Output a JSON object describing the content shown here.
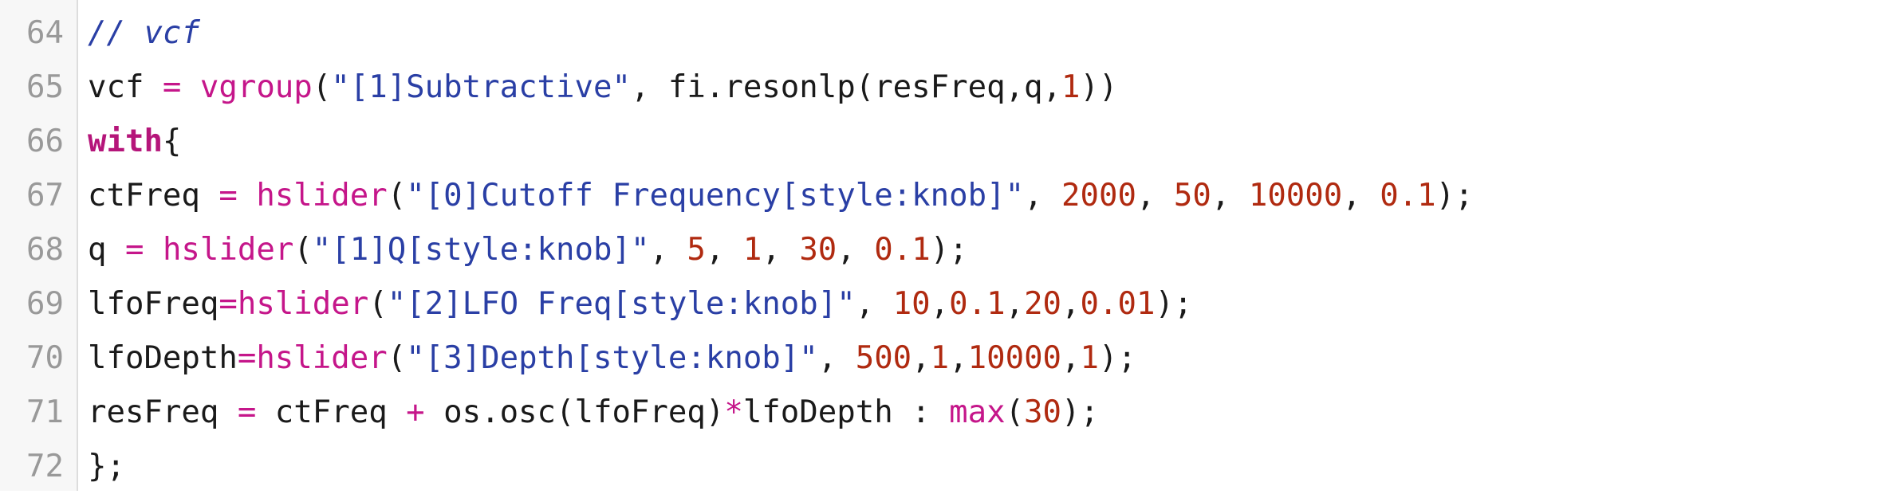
{
  "editor": {
    "language": "Faust",
    "colors": {
      "background": "#ffffff",
      "gutter": "#f7f7f7",
      "line_number": "#999999",
      "comment": "#2a3fa5",
      "keyword": "#b5157a",
      "function": "#c5168a",
      "string": "#2a3fa5",
      "number": "#b02a10",
      "text": "#1a1a1a"
    },
    "lines": [
      {
        "number": "64",
        "tokens": [
          {
            "t": "comment",
            "v": "// vcf"
          }
        ]
      },
      {
        "number": "65",
        "tokens": [
          {
            "t": "plain",
            "v": "vcf "
          },
          {
            "t": "op",
            "v": "="
          },
          {
            "t": "plain",
            "v": " "
          },
          {
            "t": "func",
            "v": "vgroup"
          },
          {
            "t": "plain",
            "v": "("
          },
          {
            "t": "string",
            "v": "\"[1]Subtractive\""
          },
          {
            "t": "plain",
            "v": ", fi.resonlp(resFreq,q,"
          },
          {
            "t": "number",
            "v": "1"
          },
          {
            "t": "plain",
            "v": "))"
          }
        ]
      },
      {
        "number": "66",
        "tokens": [
          {
            "t": "keyword",
            "v": "with"
          },
          {
            "t": "plain",
            "v": "{"
          }
        ]
      },
      {
        "number": "67",
        "tokens": [
          {
            "t": "plain",
            "v": "ctFreq "
          },
          {
            "t": "op",
            "v": "="
          },
          {
            "t": "plain",
            "v": " "
          },
          {
            "t": "func",
            "v": "hslider"
          },
          {
            "t": "plain",
            "v": "("
          },
          {
            "t": "string",
            "v": "\"[0]Cutoff Frequency[style:knob]\""
          },
          {
            "t": "plain",
            "v": ", "
          },
          {
            "t": "number",
            "v": "2000"
          },
          {
            "t": "plain",
            "v": ", "
          },
          {
            "t": "number",
            "v": "50"
          },
          {
            "t": "plain",
            "v": ", "
          },
          {
            "t": "number",
            "v": "10000"
          },
          {
            "t": "plain",
            "v": ", "
          },
          {
            "t": "number",
            "v": "0.1"
          },
          {
            "t": "plain",
            "v": ");"
          }
        ]
      },
      {
        "number": "68",
        "tokens": [
          {
            "t": "plain",
            "v": "q "
          },
          {
            "t": "op",
            "v": "="
          },
          {
            "t": "plain",
            "v": " "
          },
          {
            "t": "func",
            "v": "hslider"
          },
          {
            "t": "plain",
            "v": "("
          },
          {
            "t": "string",
            "v": "\"[1]Q[style:knob]\""
          },
          {
            "t": "plain",
            "v": ", "
          },
          {
            "t": "number",
            "v": "5"
          },
          {
            "t": "plain",
            "v": ", "
          },
          {
            "t": "number",
            "v": "1"
          },
          {
            "t": "plain",
            "v": ", "
          },
          {
            "t": "number",
            "v": "30"
          },
          {
            "t": "plain",
            "v": ", "
          },
          {
            "t": "number",
            "v": "0.1"
          },
          {
            "t": "plain",
            "v": ");"
          }
        ]
      },
      {
        "number": "69",
        "tokens": [
          {
            "t": "plain",
            "v": "lfoFreq"
          },
          {
            "t": "op",
            "v": "="
          },
          {
            "t": "func",
            "v": "hslider"
          },
          {
            "t": "plain",
            "v": "("
          },
          {
            "t": "string",
            "v": "\"[2]LFO Freq[style:knob]\""
          },
          {
            "t": "plain",
            "v": ", "
          },
          {
            "t": "number",
            "v": "10"
          },
          {
            "t": "plain",
            "v": ","
          },
          {
            "t": "number",
            "v": "0.1"
          },
          {
            "t": "plain",
            "v": ","
          },
          {
            "t": "number",
            "v": "20"
          },
          {
            "t": "plain",
            "v": ","
          },
          {
            "t": "number",
            "v": "0.01"
          },
          {
            "t": "plain",
            "v": ");"
          }
        ]
      },
      {
        "number": "70",
        "tokens": [
          {
            "t": "plain",
            "v": "lfoDepth"
          },
          {
            "t": "op",
            "v": "="
          },
          {
            "t": "func",
            "v": "hslider"
          },
          {
            "t": "plain",
            "v": "("
          },
          {
            "t": "string",
            "v": "\"[3]Depth[style:knob]\""
          },
          {
            "t": "plain",
            "v": ", "
          },
          {
            "t": "number",
            "v": "500"
          },
          {
            "t": "plain",
            "v": ","
          },
          {
            "t": "number",
            "v": "1"
          },
          {
            "t": "plain",
            "v": ","
          },
          {
            "t": "number",
            "v": "10000"
          },
          {
            "t": "plain",
            "v": ","
          },
          {
            "t": "number",
            "v": "1"
          },
          {
            "t": "plain",
            "v": ");"
          }
        ]
      },
      {
        "number": "71",
        "tokens": [
          {
            "t": "plain",
            "v": "resFreq "
          },
          {
            "t": "op",
            "v": "="
          },
          {
            "t": "plain",
            "v": " ctFreq "
          },
          {
            "t": "op",
            "v": "+"
          },
          {
            "t": "plain",
            "v": " os.osc(lfoFreq)"
          },
          {
            "t": "op",
            "v": "*"
          },
          {
            "t": "plain",
            "v": "lfoDepth : "
          },
          {
            "t": "func",
            "v": "max"
          },
          {
            "t": "plain",
            "v": "("
          },
          {
            "t": "number",
            "v": "30"
          },
          {
            "t": "plain",
            "v": ");"
          }
        ]
      },
      {
        "number": "72",
        "tokens": [
          {
            "t": "plain",
            "v": "};"
          }
        ]
      }
    ]
  }
}
